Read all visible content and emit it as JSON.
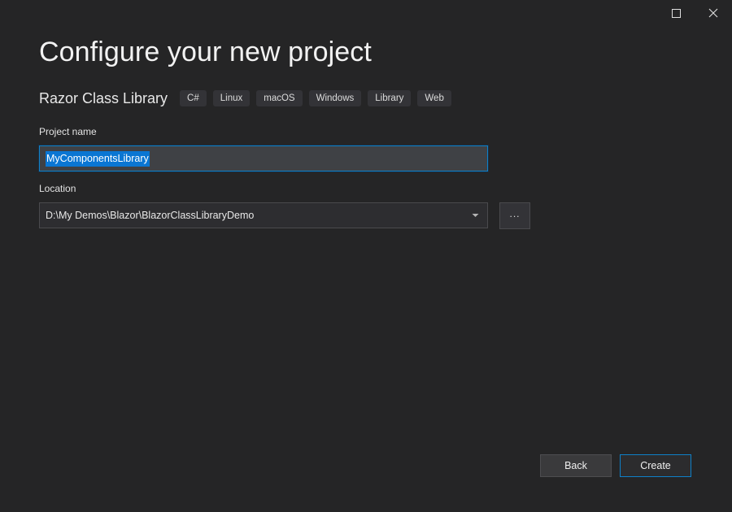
{
  "window": {
    "controls": [
      {
        "name": "maximize-button",
        "icon": "maximize-icon",
        "label": "Maximize"
      },
      {
        "name": "close-button",
        "icon": "close-icon",
        "label": "Close"
      }
    ]
  },
  "page": {
    "title": "Configure your new project"
  },
  "template": {
    "name": "Razor Class Library",
    "tags": [
      "C#",
      "Linux",
      "macOS",
      "Windows",
      "Library",
      "Web"
    ]
  },
  "fields": {
    "project_name": {
      "label": "Project name",
      "value": "MyComponentsLibrary",
      "placeholder": "Project name",
      "selected": true
    },
    "location": {
      "label": "Location",
      "value": "D:\\My Demos\\Blazor\\BlazorClassLibraryDemo",
      "placeholder": "Location",
      "browse_label": "...",
      "dropdown_icon": "chevron-down-icon"
    }
  },
  "footer": {
    "back_label": "Back",
    "create_label": "Create"
  },
  "colors": {
    "background": "#252526",
    "accent": "#0e80c8",
    "selection": "#0a76d3",
    "field_focused_bg": "#3f4145",
    "field_bg": "#2d2d30",
    "tag_bg": "#333337",
    "text": "#f0f0f0"
  }
}
